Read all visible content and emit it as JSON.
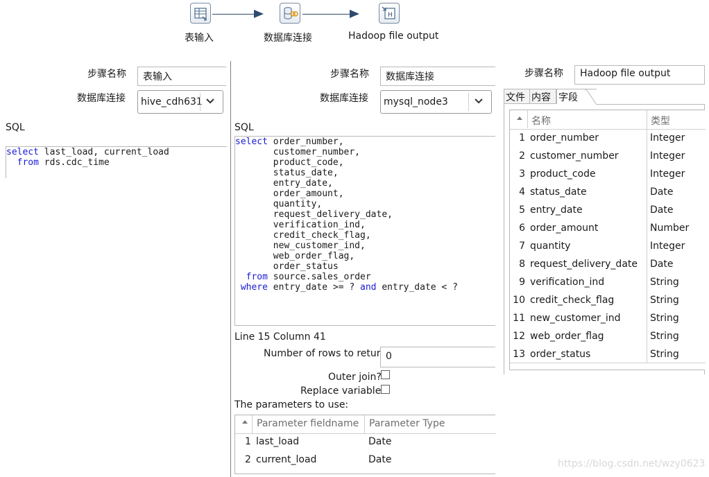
{
  "flow": {
    "steps": [
      {
        "label": "表输入",
        "icon": "table-input-icon"
      },
      {
        "label": "数据库连接",
        "icon": "database-join-icon"
      },
      {
        "label": "Hadoop file output",
        "icon": "hadoop-output-icon"
      }
    ]
  },
  "left": {
    "step_name_label": "步骤名称",
    "step_name_value": "表输入",
    "db_label": "数据库连接",
    "db_value": "hive_cdh631",
    "sql_label": "SQL",
    "sql_lines": [
      [
        {
          "t": "select",
          "kw": true
        },
        {
          "t": " last_load, current_load"
        }
      ],
      [
        {
          "t": "  "
        },
        {
          "t": "from",
          "kw": true
        },
        {
          "t": " rds.cdc_time"
        }
      ]
    ]
  },
  "middle": {
    "step_name_label": "步骤名称",
    "step_name_value": "数据库连接",
    "db_label": "数据库连接",
    "db_value": "mysql_node3",
    "sql_label": "SQL",
    "sql_lines": [
      [
        {
          "t": "select",
          "kw": true
        },
        {
          "t": " order_number,"
        }
      ],
      [
        {
          "t": "       customer_number,"
        }
      ],
      [
        {
          "t": "       product_code,"
        }
      ],
      [
        {
          "t": "       status_date,"
        }
      ],
      [
        {
          "t": "       entry_date,"
        }
      ],
      [
        {
          "t": "       order_amount,"
        }
      ],
      [
        {
          "t": "       quantity,"
        }
      ],
      [
        {
          "t": "       request_delivery_date,"
        }
      ],
      [
        {
          "t": "       verification_ind,"
        }
      ],
      [
        {
          "t": "       credit_check_flag,"
        }
      ],
      [
        {
          "t": "       new_customer_ind,"
        }
      ],
      [
        {
          "t": "       web_order_flag,"
        }
      ],
      [
        {
          "t": "       order_status"
        }
      ],
      [
        {
          "t": "  "
        },
        {
          "t": "from",
          "kw": true
        },
        {
          "t": " source.sales_order"
        }
      ],
      [
        {
          "t": " "
        },
        {
          "t": "where",
          "kw": true
        },
        {
          "t": " entry_date >= ? "
        },
        {
          "t": "and",
          "kw": true
        },
        {
          "t": " entry_date < ?"
        }
      ]
    ],
    "cursor_status": "Line 15 Column 41",
    "rows_label": "Number of rows to return",
    "rows_value": "0",
    "outer_join_label": "Outer join?",
    "replace_vars_label": "Replace variables",
    "params_label": "The parameters to use:",
    "params_headers": [
      "Parameter fieldname",
      "Parameter Type"
    ],
    "params_rows": [
      {
        "num": "1",
        "name": "last_load",
        "type": "Date"
      },
      {
        "num": "2",
        "name": "current_load",
        "type": "Date"
      }
    ]
  },
  "right": {
    "step_name_label": "步骤名称",
    "step_name_value": "Hadoop file output",
    "tabs": [
      "文件",
      "内容",
      "字段"
    ],
    "active_tab": "字段",
    "headers": [
      "名称",
      "类型"
    ],
    "fields": [
      {
        "num": "1",
        "name": "order_number",
        "type": "Integer"
      },
      {
        "num": "2",
        "name": "customer_number",
        "type": "Integer"
      },
      {
        "num": "3",
        "name": "product_code",
        "type": "Integer"
      },
      {
        "num": "4",
        "name": "status_date",
        "type": "Date"
      },
      {
        "num": "5",
        "name": "entry_date",
        "type": "Date"
      },
      {
        "num": "6",
        "name": "order_amount",
        "type": "Number"
      },
      {
        "num": "7",
        "name": "quantity",
        "type": "Integer"
      },
      {
        "num": "8",
        "name": "request_delivery_date",
        "type": "Date"
      },
      {
        "num": "9",
        "name": "verification_ind",
        "type": "String"
      },
      {
        "num": "10",
        "name": "credit_check_flag",
        "type": "String"
      },
      {
        "num": "11",
        "name": "new_customer_ind",
        "type": "String"
      },
      {
        "num": "12",
        "name": "web_order_flag",
        "type": "String"
      },
      {
        "num": "13",
        "name": "order_status",
        "type": "String"
      }
    ]
  },
  "watermark": "https://blog.csdn.net/wzy0623"
}
